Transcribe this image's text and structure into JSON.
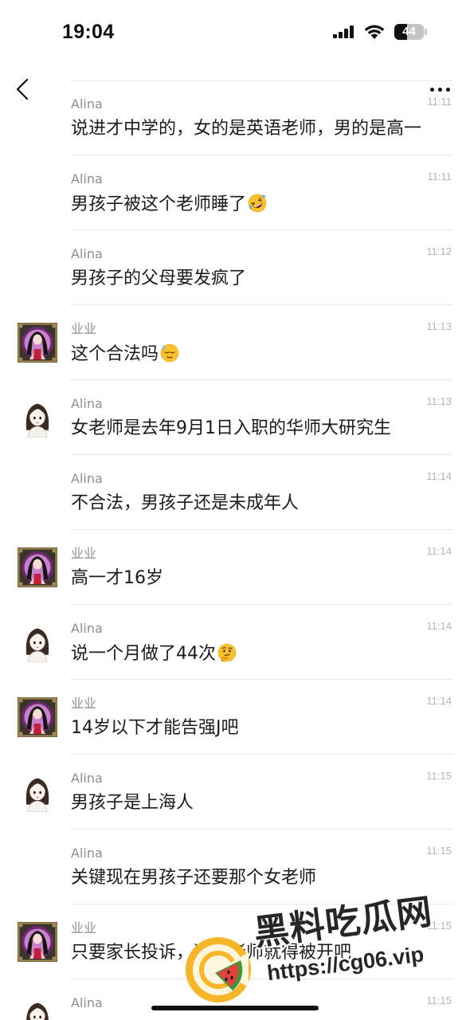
{
  "status_bar": {
    "time": "19:04",
    "battery": "44",
    "battery_level": 0.44,
    "icons": [
      "cellular-signal-icon",
      "wifi-icon",
      "battery-icon"
    ]
  },
  "nav": {
    "back_icon": "chevron-left-icon",
    "more_icon": "more-dots-icon"
  },
  "messages": [
    {
      "sender": "Alina",
      "time": "11:11",
      "text": "说进才中学的，女的是英语老师，男的是高一",
      "avatar": "",
      "emoji": ""
    },
    {
      "sender": "Alina",
      "time": "11:11",
      "text": "男孩子被这个老师睡了",
      "avatar": "",
      "emoji": "rolling-on-the-floor-laughing"
    },
    {
      "sender": "Alina",
      "time": "11:12",
      "text": "男孩子的父母要发疯了",
      "avatar": "",
      "emoji": ""
    },
    {
      "sender": "业业",
      "time": "11:13",
      "text": "这个合法吗",
      "avatar": "yeye-avatar",
      "emoji": "downcast-face-with-sweat"
    },
    {
      "sender": "Alina",
      "time": "11:13",
      "text": "女老师是去年9月1日入职的华师大研究生",
      "avatar": "alina-avatar",
      "emoji": ""
    },
    {
      "sender": "Alina",
      "time": "11:14",
      "text": "不合法，男孩子还是未成年人",
      "avatar": "",
      "emoji": ""
    },
    {
      "sender": "业业",
      "time": "11:14",
      "text": "高一才16岁",
      "avatar": "yeye-avatar",
      "emoji": ""
    },
    {
      "sender": "Alina",
      "time": "11:14",
      "text": "说一个月做了44次",
      "avatar": "alina-avatar",
      "emoji": "thinking-face"
    },
    {
      "sender": "业业",
      "time": "11:14",
      "text": "14岁以下才能告强J吧",
      "avatar": "yeye-avatar",
      "emoji": ""
    },
    {
      "sender": "Alina",
      "time": "11:15",
      "text": "男孩子是上海人",
      "avatar": "alina-avatar",
      "emoji": ""
    },
    {
      "sender": "Alina",
      "time": "11:15",
      "text": "关键现在男孩子还要那个女老师",
      "avatar": "",
      "emoji": ""
    },
    {
      "sender": "业业",
      "time": "11:15",
      "text": "只要家长投诉，这个老师就得被开吧",
      "avatar": "yeye-avatar",
      "emoji": ""
    },
    {
      "sender": "Alina",
      "time": "11:15",
      "text": "",
      "avatar": "alina-avatar",
      "emoji": ""
    }
  ],
  "watermark": {
    "brand": "黑料吃瓜网",
    "url": "https://cg06.vip",
    "logo_icon": "watermelon-c-logo"
  }
}
